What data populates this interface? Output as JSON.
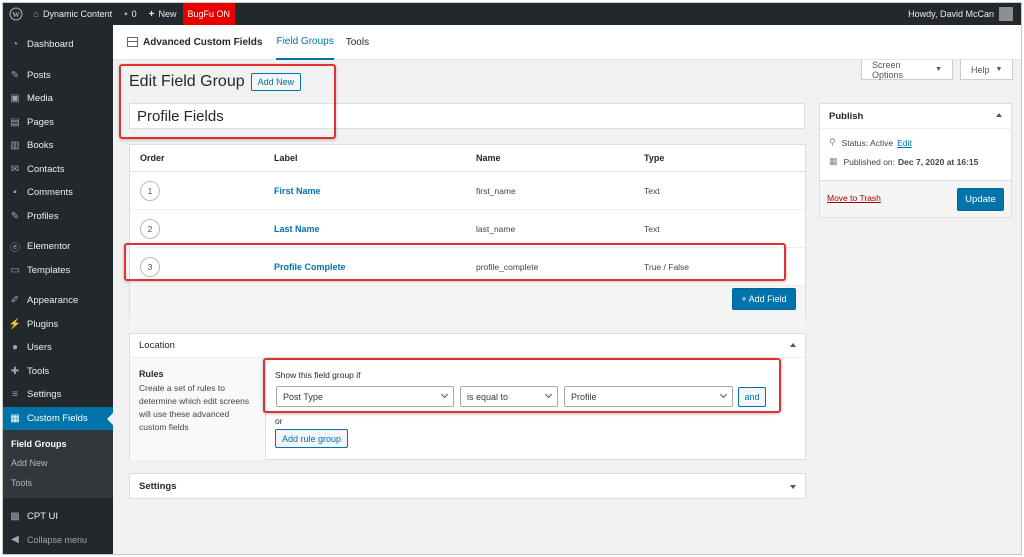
{
  "admin_bar": {
    "site_name": "Dynamic Content",
    "comments_count": "0",
    "new_label": "New",
    "bugfu_label": "BugFu ON",
    "greeting": "Howdy, David McCan"
  },
  "sidebar": {
    "items": [
      {
        "label": "Dashboard",
        "icon": "dashboard-icon"
      },
      {
        "label": "Posts",
        "icon": "pin-icon"
      },
      {
        "label": "Media",
        "icon": "media-icon"
      },
      {
        "label": "Pages",
        "icon": "page-icon"
      },
      {
        "label": "Books",
        "icon": "book-icon"
      },
      {
        "label": "Contacts",
        "icon": "mail-icon"
      },
      {
        "label": "Comments",
        "icon": "comment-icon"
      },
      {
        "label": "Profiles",
        "icon": "pin-icon"
      },
      {
        "label": "Elementor",
        "icon": "elementor-icon"
      },
      {
        "label": "Templates",
        "icon": "folder-icon"
      },
      {
        "label": "Appearance",
        "icon": "brush-icon"
      },
      {
        "label": "Plugins",
        "icon": "plug-icon"
      },
      {
        "label": "Users",
        "icon": "user-icon"
      },
      {
        "label": "Tools",
        "icon": "wrench-icon"
      },
      {
        "label": "Settings",
        "icon": "sliders-icon"
      },
      {
        "label": "Custom Fields",
        "icon": "grid-icon"
      }
    ],
    "submenu": [
      "Field Groups",
      "Add New",
      "Tools"
    ],
    "cpt_ui": "CPT UI",
    "collapse": "Collapse menu"
  },
  "acf_nav": {
    "title": "Advanced Custom Fields",
    "tabs": [
      "Field Groups",
      "Tools"
    ]
  },
  "screen_options": "Screen Options",
  "help": "Help",
  "page": {
    "title": "Edit Field Group",
    "add_new": "Add New",
    "group_title": "Profile Fields"
  },
  "fields_table": {
    "headers": [
      "Order",
      "Label",
      "Name",
      "Type"
    ],
    "rows": [
      {
        "order": "1",
        "label": "First Name",
        "name": "first_name",
        "type": "Text"
      },
      {
        "order": "2",
        "label": "Last Name",
        "name": "last_name",
        "type": "Text"
      },
      {
        "order": "3",
        "label": "Profile Complete",
        "name": "profile_complete",
        "type": "True / False"
      }
    ],
    "add_field": "+ Add Field"
  },
  "publish": {
    "title": "Publish",
    "status_label": "Status: Active",
    "status_edit": "Edit",
    "published_label": "Published on:",
    "published_date": "Dec 7, 2020 at 16:15",
    "trash": "Move to Trash",
    "update": "Update"
  },
  "location": {
    "title": "Location",
    "rules_title": "Rules",
    "rules_desc": "Create a set of rules to determine which edit screens will use these advanced custom fields",
    "show_if": "Show this field group if",
    "param": "Post Type",
    "operator": "is equal to",
    "value": "Profile",
    "and": "and",
    "or": "or",
    "add_rule_group": "Add rule group"
  },
  "settings": {
    "title": "Settings"
  },
  "colors": {
    "accent": "#0073aa",
    "admin_bar": "#23282d",
    "bugfu": "#e60000",
    "highlight": "#e03030"
  }
}
